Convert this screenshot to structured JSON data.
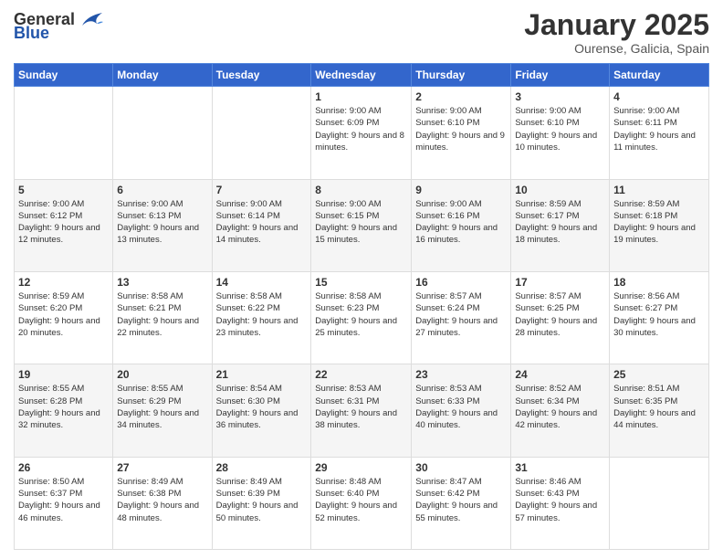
{
  "header": {
    "logo_general": "General",
    "logo_blue": "Blue",
    "month_title": "January 2025",
    "location": "Ourense, Galicia, Spain"
  },
  "weekdays": [
    "Sunday",
    "Monday",
    "Tuesday",
    "Wednesday",
    "Thursday",
    "Friday",
    "Saturday"
  ],
  "weeks": [
    [
      {
        "day": "",
        "info": ""
      },
      {
        "day": "",
        "info": ""
      },
      {
        "day": "",
        "info": ""
      },
      {
        "day": "1",
        "info": "Sunrise: 9:00 AM\nSunset: 6:09 PM\nDaylight: 9 hours and 8 minutes."
      },
      {
        "day": "2",
        "info": "Sunrise: 9:00 AM\nSunset: 6:10 PM\nDaylight: 9 hours and 9 minutes."
      },
      {
        "day": "3",
        "info": "Sunrise: 9:00 AM\nSunset: 6:10 PM\nDaylight: 9 hours and 10 minutes."
      },
      {
        "day": "4",
        "info": "Sunrise: 9:00 AM\nSunset: 6:11 PM\nDaylight: 9 hours and 11 minutes."
      }
    ],
    [
      {
        "day": "5",
        "info": "Sunrise: 9:00 AM\nSunset: 6:12 PM\nDaylight: 9 hours and 12 minutes."
      },
      {
        "day": "6",
        "info": "Sunrise: 9:00 AM\nSunset: 6:13 PM\nDaylight: 9 hours and 13 minutes."
      },
      {
        "day": "7",
        "info": "Sunrise: 9:00 AM\nSunset: 6:14 PM\nDaylight: 9 hours and 14 minutes."
      },
      {
        "day": "8",
        "info": "Sunrise: 9:00 AM\nSunset: 6:15 PM\nDaylight: 9 hours and 15 minutes."
      },
      {
        "day": "9",
        "info": "Sunrise: 9:00 AM\nSunset: 6:16 PM\nDaylight: 9 hours and 16 minutes."
      },
      {
        "day": "10",
        "info": "Sunrise: 8:59 AM\nSunset: 6:17 PM\nDaylight: 9 hours and 18 minutes."
      },
      {
        "day": "11",
        "info": "Sunrise: 8:59 AM\nSunset: 6:18 PM\nDaylight: 9 hours and 19 minutes."
      }
    ],
    [
      {
        "day": "12",
        "info": "Sunrise: 8:59 AM\nSunset: 6:20 PM\nDaylight: 9 hours and 20 minutes."
      },
      {
        "day": "13",
        "info": "Sunrise: 8:58 AM\nSunset: 6:21 PM\nDaylight: 9 hours and 22 minutes."
      },
      {
        "day": "14",
        "info": "Sunrise: 8:58 AM\nSunset: 6:22 PM\nDaylight: 9 hours and 23 minutes."
      },
      {
        "day": "15",
        "info": "Sunrise: 8:58 AM\nSunset: 6:23 PM\nDaylight: 9 hours and 25 minutes."
      },
      {
        "day": "16",
        "info": "Sunrise: 8:57 AM\nSunset: 6:24 PM\nDaylight: 9 hours and 27 minutes."
      },
      {
        "day": "17",
        "info": "Sunrise: 8:57 AM\nSunset: 6:25 PM\nDaylight: 9 hours and 28 minutes."
      },
      {
        "day": "18",
        "info": "Sunrise: 8:56 AM\nSunset: 6:27 PM\nDaylight: 9 hours and 30 minutes."
      }
    ],
    [
      {
        "day": "19",
        "info": "Sunrise: 8:55 AM\nSunset: 6:28 PM\nDaylight: 9 hours and 32 minutes."
      },
      {
        "day": "20",
        "info": "Sunrise: 8:55 AM\nSunset: 6:29 PM\nDaylight: 9 hours and 34 minutes."
      },
      {
        "day": "21",
        "info": "Sunrise: 8:54 AM\nSunset: 6:30 PM\nDaylight: 9 hours and 36 minutes."
      },
      {
        "day": "22",
        "info": "Sunrise: 8:53 AM\nSunset: 6:31 PM\nDaylight: 9 hours and 38 minutes."
      },
      {
        "day": "23",
        "info": "Sunrise: 8:53 AM\nSunset: 6:33 PM\nDaylight: 9 hours and 40 minutes."
      },
      {
        "day": "24",
        "info": "Sunrise: 8:52 AM\nSunset: 6:34 PM\nDaylight: 9 hours and 42 minutes."
      },
      {
        "day": "25",
        "info": "Sunrise: 8:51 AM\nSunset: 6:35 PM\nDaylight: 9 hours and 44 minutes."
      }
    ],
    [
      {
        "day": "26",
        "info": "Sunrise: 8:50 AM\nSunset: 6:37 PM\nDaylight: 9 hours and 46 minutes."
      },
      {
        "day": "27",
        "info": "Sunrise: 8:49 AM\nSunset: 6:38 PM\nDaylight: 9 hours and 48 minutes."
      },
      {
        "day": "28",
        "info": "Sunrise: 8:49 AM\nSunset: 6:39 PM\nDaylight: 9 hours and 50 minutes."
      },
      {
        "day": "29",
        "info": "Sunrise: 8:48 AM\nSunset: 6:40 PM\nDaylight: 9 hours and 52 minutes."
      },
      {
        "day": "30",
        "info": "Sunrise: 8:47 AM\nSunset: 6:42 PM\nDaylight: 9 hours and 55 minutes."
      },
      {
        "day": "31",
        "info": "Sunrise: 8:46 AM\nSunset: 6:43 PM\nDaylight: 9 hours and 57 minutes."
      },
      {
        "day": "",
        "info": ""
      }
    ]
  ]
}
